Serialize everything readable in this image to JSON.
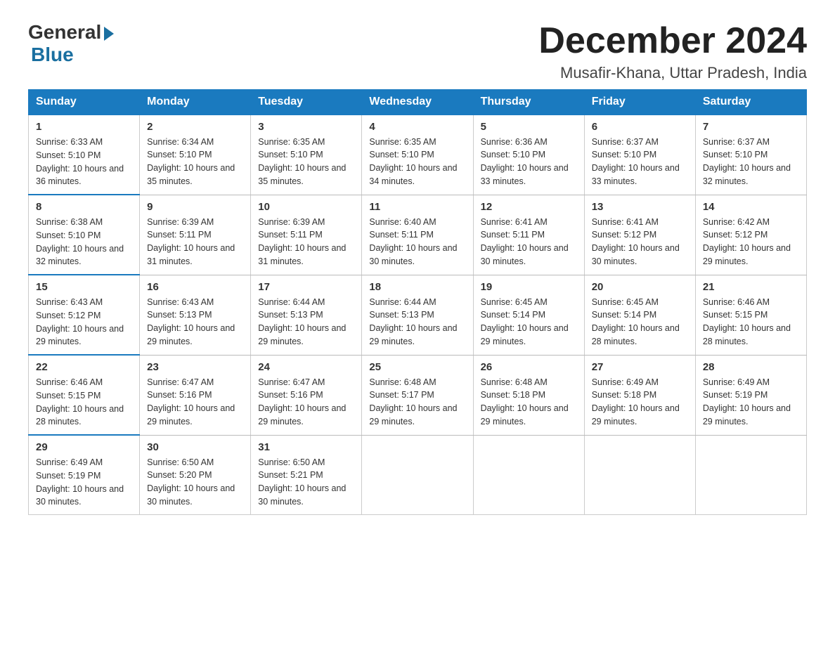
{
  "logo": {
    "general": "General",
    "blue": "Blue"
  },
  "title": "December 2024",
  "location": "Musafir-Khana, Uttar Pradesh, India",
  "weekdays": [
    "Sunday",
    "Monday",
    "Tuesday",
    "Wednesday",
    "Thursday",
    "Friday",
    "Saturday"
  ],
  "rows": [
    [
      {
        "day": "1",
        "sunrise": "6:33 AM",
        "sunset": "5:10 PM",
        "daylight": "10 hours and 36 minutes."
      },
      {
        "day": "2",
        "sunrise": "6:34 AM",
        "sunset": "5:10 PM",
        "daylight": "10 hours and 35 minutes."
      },
      {
        "day": "3",
        "sunrise": "6:35 AM",
        "sunset": "5:10 PM",
        "daylight": "10 hours and 35 minutes."
      },
      {
        "day": "4",
        "sunrise": "6:35 AM",
        "sunset": "5:10 PM",
        "daylight": "10 hours and 34 minutes."
      },
      {
        "day": "5",
        "sunrise": "6:36 AM",
        "sunset": "5:10 PM",
        "daylight": "10 hours and 33 minutes."
      },
      {
        "day": "6",
        "sunrise": "6:37 AM",
        "sunset": "5:10 PM",
        "daylight": "10 hours and 33 minutes."
      },
      {
        "day": "7",
        "sunrise": "6:37 AM",
        "sunset": "5:10 PM",
        "daylight": "10 hours and 32 minutes."
      }
    ],
    [
      {
        "day": "8",
        "sunrise": "6:38 AM",
        "sunset": "5:10 PM",
        "daylight": "10 hours and 32 minutes."
      },
      {
        "day": "9",
        "sunrise": "6:39 AM",
        "sunset": "5:11 PM",
        "daylight": "10 hours and 31 minutes."
      },
      {
        "day": "10",
        "sunrise": "6:39 AM",
        "sunset": "5:11 PM",
        "daylight": "10 hours and 31 minutes."
      },
      {
        "day": "11",
        "sunrise": "6:40 AM",
        "sunset": "5:11 PM",
        "daylight": "10 hours and 30 minutes."
      },
      {
        "day": "12",
        "sunrise": "6:41 AM",
        "sunset": "5:11 PM",
        "daylight": "10 hours and 30 minutes."
      },
      {
        "day": "13",
        "sunrise": "6:41 AM",
        "sunset": "5:12 PM",
        "daylight": "10 hours and 30 minutes."
      },
      {
        "day": "14",
        "sunrise": "6:42 AM",
        "sunset": "5:12 PM",
        "daylight": "10 hours and 29 minutes."
      }
    ],
    [
      {
        "day": "15",
        "sunrise": "6:43 AM",
        "sunset": "5:12 PM",
        "daylight": "10 hours and 29 minutes."
      },
      {
        "day": "16",
        "sunrise": "6:43 AM",
        "sunset": "5:13 PM",
        "daylight": "10 hours and 29 minutes."
      },
      {
        "day": "17",
        "sunrise": "6:44 AM",
        "sunset": "5:13 PM",
        "daylight": "10 hours and 29 minutes."
      },
      {
        "day": "18",
        "sunrise": "6:44 AM",
        "sunset": "5:13 PM",
        "daylight": "10 hours and 29 minutes."
      },
      {
        "day": "19",
        "sunrise": "6:45 AM",
        "sunset": "5:14 PM",
        "daylight": "10 hours and 29 minutes."
      },
      {
        "day": "20",
        "sunrise": "6:45 AM",
        "sunset": "5:14 PM",
        "daylight": "10 hours and 28 minutes."
      },
      {
        "day": "21",
        "sunrise": "6:46 AM",
        "sunset": "5:15 PM",
        "daylight": "10 hours and 28 minutes."
      }
    ],
    [
      {
        "day": "22",
        "sunrise": "6:46 AM",
        "sunset": "5:15 PM",
        "daylight": "10 hours and 28 minutes."
      },
      {
        "day": "23",
        "sunrise": "6:47 AM",
        "sunset": "5:16 PM",
        "daylight": "10 hours and 29 minutes."
      },
      {
        "day": "24",
        "sunrise": "6:47 AM",
        "sunset": "5:16 PM",
        "daylight": "10 hours and 29 minutes."
      },
      {
        "day": "25",
        "sunrise": "6:48 AM",
        "sunset": "5:17 PM",
        "daylight": "10 hours and 29 minutes."
      },
      {
        "day": "26",
        "sunrise": "6:48 AM",
        "sunset": "5:18 PM",
        "daylight": "10 hours and 29 minutes."
      },
      {
        "day": "27",
        "sunrise": "6:49 AM",
        "sunset": "5:18 PM",
        "daylight": "10 hours and 29 minutes."
      },
      {
        "day": "28",
        "sunrise": "6:49 AM",
        "sunset": "5:19 PM",
        "daylight": "10 hours and 29 minutes."
      }
    ],
    [
      {
        "day": "29",
        "sunrise": "6:49 AM",
        "sunset": "5:19 PM",
        "daylight": "10 hours and 30 minutes."
      },
      {
        "day": "30",
        "sunrise": "6:50 AM",
        "sunset": "5:20 PM",
        "daylight": "10 hours and 30 minutes."
      },
      {
        "day": "31",
        "sunrise": "6:50 AM",
        "sunset": "5:21 PM",
        "daylight": "10 hours and 30 minutes."
      },
      null,
      null,
      null,
      null
    ]
  ]
}
